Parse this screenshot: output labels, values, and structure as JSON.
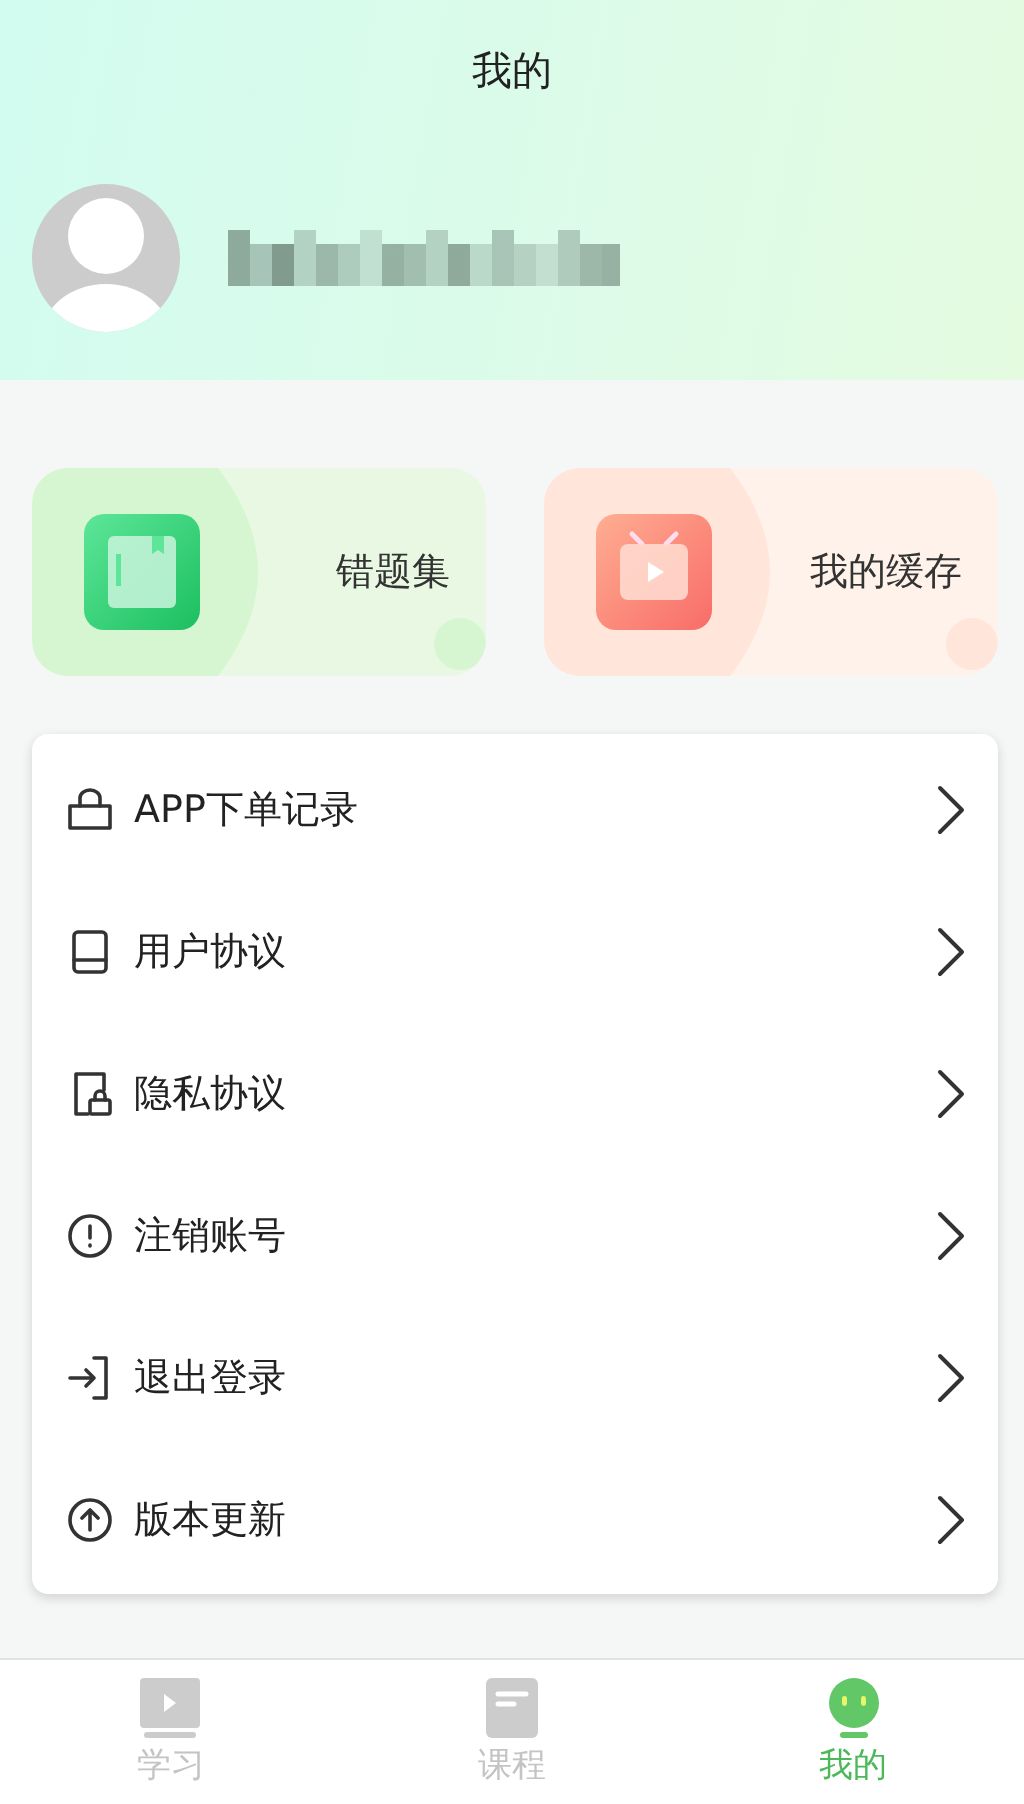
{
  "header": {
    "title": "我的"
  },
  "shortcuts": [
    {
      "kind": "book",
      "label": "错题集"
    },
    {
      "kind": "tv",
      "label": "我的缓存"
    }
  ],
  "menu": [
    {
      "kind": "bag",
      "label": "APP下单记录"
    },
    {
      "kind": "book",
      "label": "用户协议"
    },
    {
      "kind": "lock",
      "label": "隐私协议"
    },
    {
      "kind": "alert",
      "label": "注销账号"
    },
    {
      "kind": "logout",
      "label": "退出登录"
    },
    {
      "kind": "upgrade",
      "label": "版本更新"
    }
  ],
  "tabs": [
    {
      "kind": "video",
      "label": "学习",
      "selected": false
    },
    {
      "kind": "doc",
      "label": "课程",
      "selected": false
    },
    {
      "kind": "face",
      "label": "我的",
      "selected": true
    }
  ]
}
